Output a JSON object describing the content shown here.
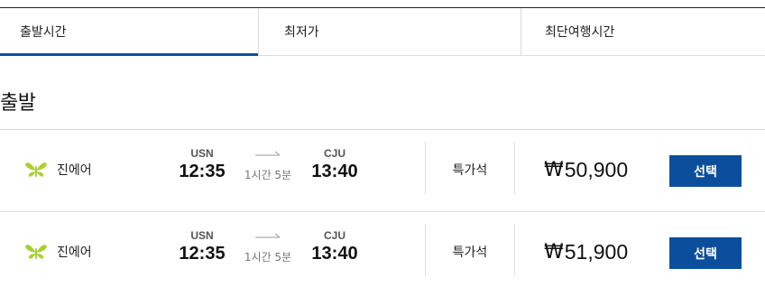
{
  "tabs": [
    {
      "label": "출발시간",
      "active": true
    },
    {
      "label": "최저가",
      "active": false
    },
    {
      "label": "최단여행시간",
      "active": false
    }
  ],
  "section_title": "출발",
  "flights": [
    {
      "airline": "진에어",
      "logo_icon": "butterfly-logo",
      "dep_code": "USN",
      "dep_time": "12:35",
      "duration": "1시간 5분",
      "arr_code": "CJU",
      "arr_time": "13:40",
      "seat_class": "특가석",
      "currency": "₩",
      "price": "50,900",
      "button_label": "선택"
    },
    {
      "airline": "진에어",
      "logo_icon": "butterfly-logo",
      "dep_code": "USN",
      "dep_time": "12:35",
      "duration": "1시간 5분",
      "arr_code": "CJU",
      "arr_time": "13:40",
      "seat_class": "특가석",
      "currency": "₩",
      "price": "51,900",
      "button_label": "선택"
    }
  ],
  "colors": {
    "accent": "#0b4f9c",
    "logo_green": "#a9d12a"
  }
}
